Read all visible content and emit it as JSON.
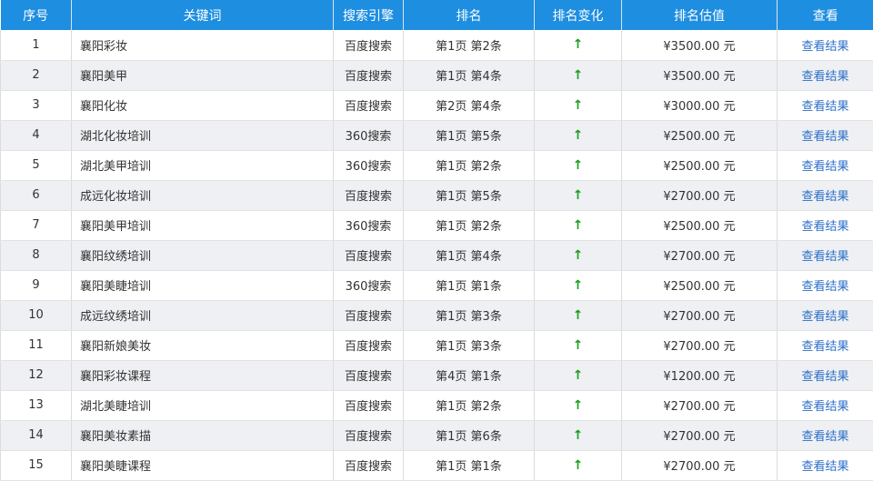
{
  "table": {
    "headers": [
      "序号",
      "关键词",
      "搜索引擎",
      "排名",
      "排名变化",
      "排名估值",
      "查看"
    ],
    "rows": [
      {
        "index": "1",
        "keyword": "襄阳彩妆",
        "engine": "百度搜索",
        "rank": "第1页 第2条",
        "change": "↑",
        "value": "¥3500.00 元",
        "action": "查看结果"
      },
      {
        "index": "2",
        "keyword": "襄阳美甲",
        "engine": "百度搜索",
        "rank": "第1页 第4条",
        "change": "↑",
        "value": "¥3500.00 元",
        "action": "查看结果"
      },
      {
        "index": "3",
        "keyword": "襄阳化妆",
        "engine": "百度搜索",
        "rank": "第2页 第4条",
        "change": "↑",
        "value": "¥3000.00 元",
        "action": "查看结果"
      },
      {
        "index": "4",
        "keyword": "湖北化妆培训",
        "engine": "360搜索",
        "rank": "第1页 第5条",
        "change": "↑",
        "value": "¥2500.00 元",
        "action": "查看结果"
      },
      {
        "index": "5",
        "keyword": "湖北美甲培训",
        "engine": "360搜索",
        "rank": "第1页 第2条",
        "change": "↑",
        "value": "¥2500.00 元",
        "action": "查看结果"
      },
      {
        "index": "6",
        "keyword": "成远化妆培训",
        "engine": "百度搜索",
        "rank": "第1页 第5条",
        "change": "↑",
        "value": "¥2700.00 元",
        "action": "查看结果"
      },
      {
        "index": "7",
        "keyword": "襄阳美甲培训",
        "engine": "360搜索",
        "rank": "第1页 第2条",
        "change": "↑",
        "value": "¥2500.00 元",
        "action": "查看结果"
      },
      {
        "index": "8",
        "keyword": "襄阳纹绣培训",
        "engine": "百度搜索",
        "rank": "第1页 第4条",
        "change": "↑",
        "value": "¥2700.00 元",
        "action": "查看结果"
      },
      {
        "index": "9",
        "keyword": "襄阳美睫培训",
        "engine": "360搜索",
        "rank": "第1页 第1条",
        "change": "↑",
        "value": "¥2500.00 元",
        "action": "查看结果"
      },
      {
        "index": "10",
        "keyword": "成远纹绣培训",
        "engine": "百度搜索",
        "rank": "第1页 第3条",
        "change": "↑",
        "value": "¥2700.00 元",
        "action": "查看结果"
      },
      {
        "index": "11",
        "keyword": "襄阳新娘美妆",
        "engine": "百度搜索",
        "rank": "第1页 第3条",
        "change": "↑",
        "value": "¥2700.00 元",
        "action": "查看结果"
      },
      {
        "index": "12",
        "keyword": "襄阳彩妆课程",
        "engine": "百度搜索",
        "rank": "第4页 第1条",
        "change": "↑",
        "value": "¥1200.00 元",
        "action": "查看结果"
      },
      {
        "index": "13",
        "keyword": "湖北美睫培训",
        "engine": "百度搜索",
        "rank": "第1页 第2条",
        "change": "↑",
        "value": "¥2700.00 元",
        "action": "查看结果"
      },
      {
        "index": "14",
        "keyword": "襄阳美妆素描",
        "engine": "百度搜索",
        "rank": "第1页 第6条",
        "change": "↑",
        "value": "¥2700.00 元",
        "action": "查看结果"
      },
      {
        "index": "15",
        "keyword": "襄阳美睫课程",
        "engine": "百度搜索",
        "rank": "第1页 第1条",
        "change": "↑",
        "value": "¥2700.00 元",
        "action": "查看结果"
      }
    ]
  },
  "colors": {
    "header_bg": "#1e8ee0",
    "row_alt_bg": "#eef0f3",
    "arrow_up": "#1a9d1a",
    "link": "#2b6ec8"
  }
}
